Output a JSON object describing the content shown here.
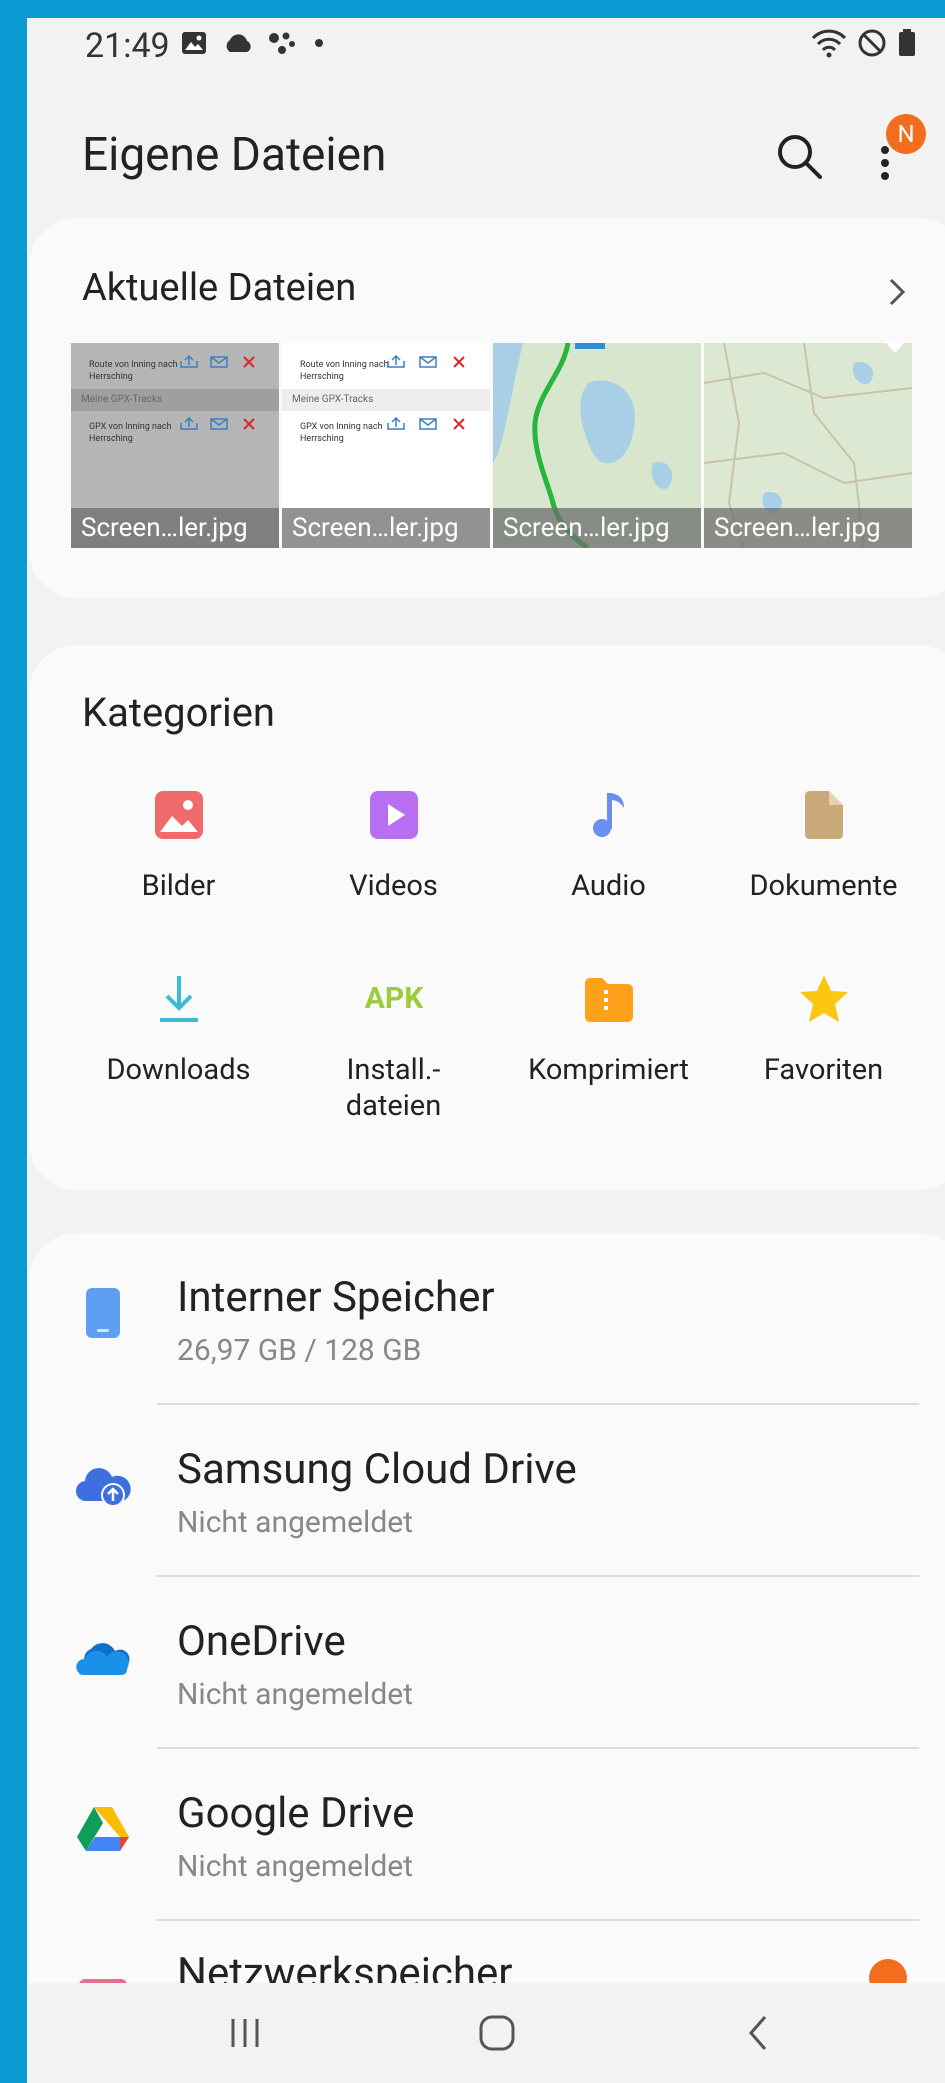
{
  "status": {
    "time": "21:49"
  },
  "appbar": {
    "title": "Eigene Dateien",
    "badge": "N"
  },
  "recent": {
    "heading": "Aktuelle Dateien",
    "files": [
      {
        "caption": "Screen…ler.jpg",
        "row1": "Route von Inning nach Herrsching",
        "section": "Meine GPX-Tracks",
        "row2": "GPX von Inning nach Herrsching"
      },
      {
        "caption": "Screen…ler.jpg",
        "row1": "Route von Inning nach Herrsching",
        "section": "Meine GPX-Tracks",
        "row2": "GPX von Inning nach Herrsching"
      },
      {
        "caption": "Screen…ler.jpg"
      },
      {
        "caption": "Screen…ler.jpg"
      }
    ]
  },
  "categories": {
    "heading": "Kategorien",
    "items": [
      {
        "label": "Bilder",
        "icon": "image-icon",
        "color": "#ef6a6a"
      },
      {
        "label": "Videos",
        "icon": "video-icon",
        "color": "#b76ef0"
      },
      {
        "label": "Audio",
        "icon": "music-note-icon",
        "color": "#6b8ef2"
      },
      {
        "label": "Dokumente",
        "icon": "document-icon",
        "color": "#caa978"
      },
      {
        "label": "Downloads",
        "icon": "download-icon",
        "color": "#3bbcd2"
      },
      {
        "label": "Install.-\ndateien",
        "icon": "apk-icon",
        "icon_text": "APK",
        "color": "#9ccc3a"
      },
      {
        "label": "Komprimiert",
        "icon": "archive-folder-icon",
        "color": "#ffa21a"
      },
      {
        "label": "Favoriten",
        "icon": "star-icon",
        "color": "#fbc712"
      }
    ]
  },
  "storage": [
    {
      "name": "Interner Speicher",
      "sub": "26,97 GB / 128 GB",
      "icon": "phone-icon"
    },
    {
      "name": "Samsung Cloud Drive",
      "sub": "Nicht angemeldet",
      "icon": "samsung-cloud-icon"
    },
    {
      "name": "OneDrive",
      "sub": "Nicht angemeldet",
      "icon": "onedrive-icon"
    },
    {
      "name": "Google Drive",
      "sub": "Nicht angemeldet",
      "icon": "google-drive-icon"
    },
    {
      "name": "Netzwerkspeicher",
      "sub": "",
      "icon": "network-storage-icon"
    }
  ]
}
